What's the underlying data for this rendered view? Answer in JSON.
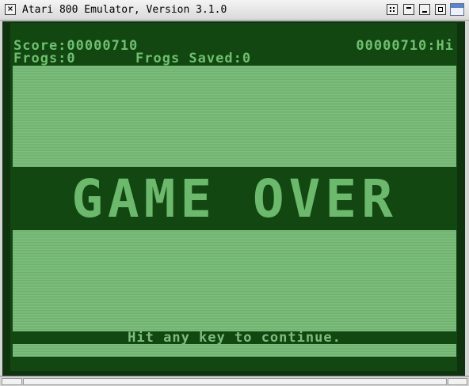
{
  "window": {
    "title": "Atari 800 Emulator, Version 3.1.0",
    "close_glyph": "×",
    "icons": [
      "close-icon",
      "window-menu-icon",
      "shade-icon",
      "minimize-icon",
      "maximize-icon",
      "app-icon"
    ]
  },
  "game": {
    "score_label": "Score:00000710",
    "hiscore_label": "00000710:Hi",
    "frogs_label": "Frogs:0",
    "saved_label": "Frogs Saved:0",
    "gameover_text": "GAME OVER",
    "continue_text": "Hit any key to continue."
  },
  "colors": {
    "screen_background": "#0e330e",
    "playfield_dark": "#124712",
    "playfield_band": "#76b876",
    "text_green": "#6fbf6f"
  }
}
